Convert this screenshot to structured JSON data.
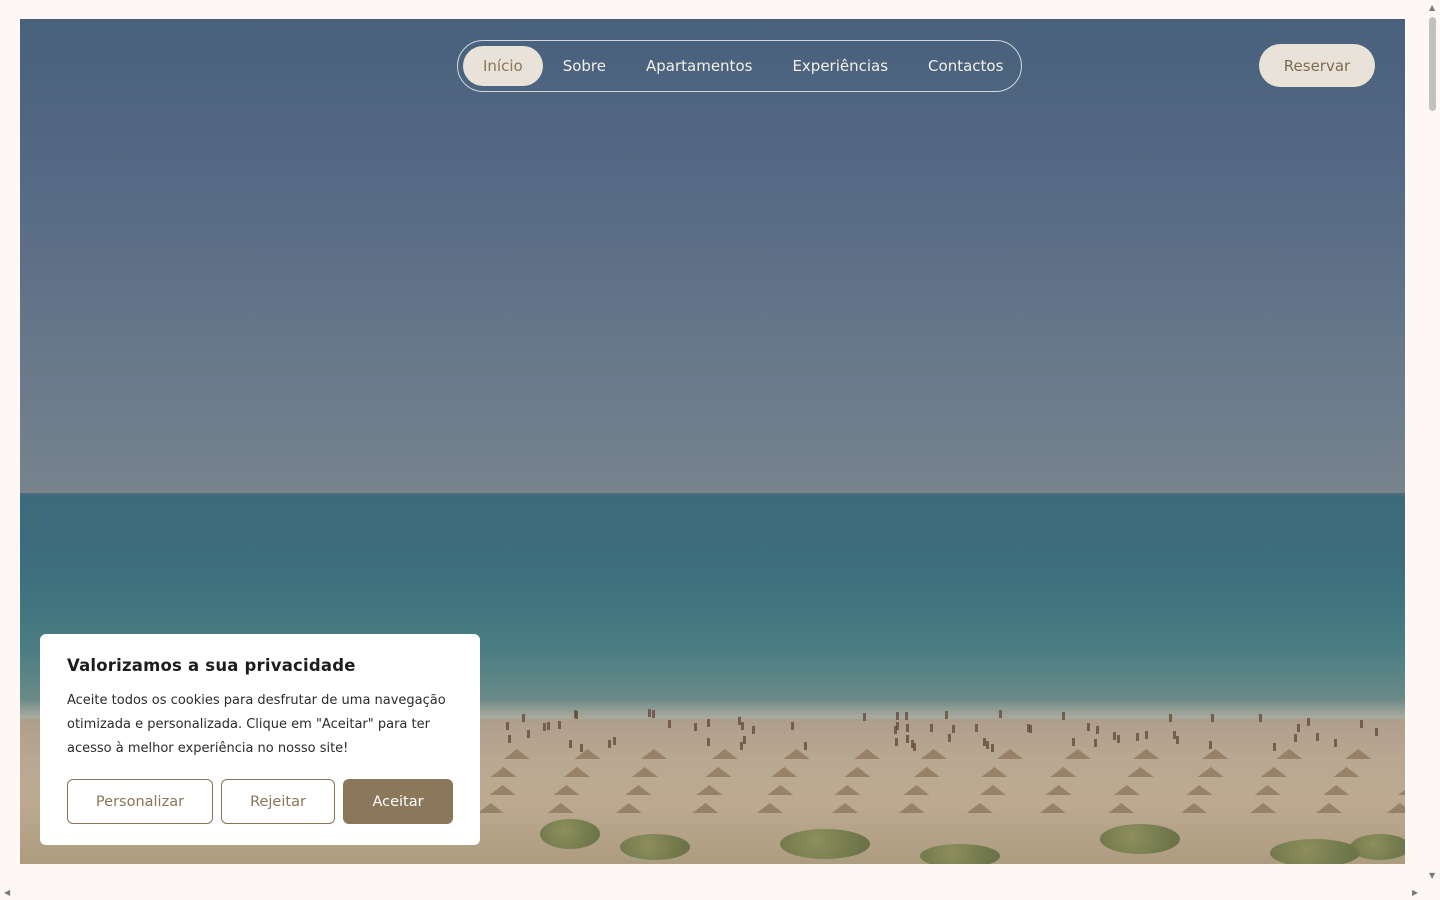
{
  "nav": {
    "items": [
      {
        "label": "Início",
        "active": true
      },
      {
        "label": "Sobre",
        "active": false
      },
      {
        "label": "Apartamentos",
        "active": false
      },
      {
        "label": "Experiências",
        "active": false
      },
      {
        "label": "Contactos",
        "active": false
      }
    ],
    "reserve_label": "Reservar"
  },
  "cookie": {
    "title": "Valorizamos a sua privacidade",
    "text": "Aceite todos os cookies para desfrutar de uma navegação otimizada e personalizada. Clique em \"Aceitar\" para ter acesso à melhor experiência no nosso site!",
    "customize_label": "Personalizar",
    "reject_label": "Rejeitar",
    "accept_label": "Aceitar"
  },
  "colors": {
    "accent": "#8b7759",
    "pill_bg": "#e9e2d8",
    "page_bg": "#fdf8f5"
  },
  "icons": {
    "scroll_up": "chevron-up-icon",
    "scroll_down": "chevron-down-icon",
    "scroll_left": "chevron-left-icon",
    "scroll_right": "chevron-right-icon"
  }
}
